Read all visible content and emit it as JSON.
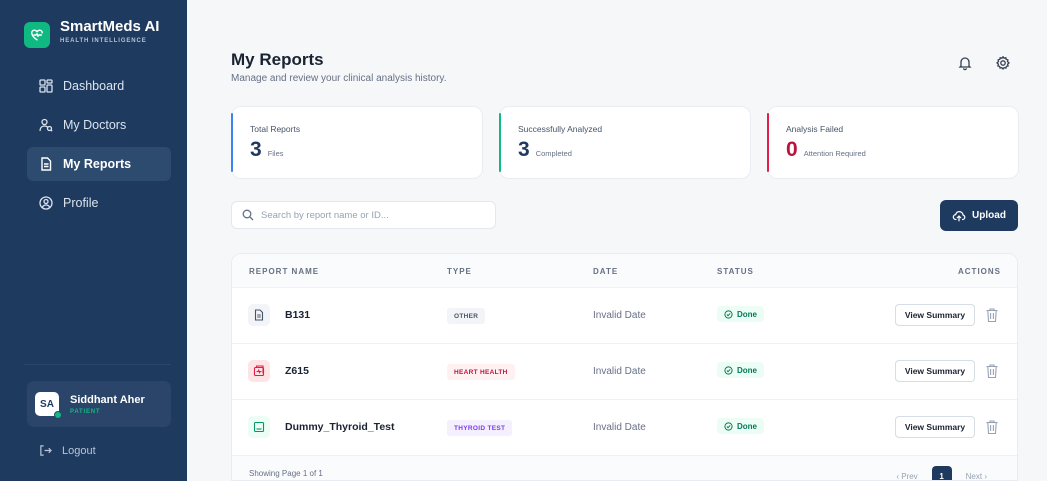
{
  "brand": {
    "name": "SmartMeds AI",
    "tagline": "HEALTH INTELLIGENCE"
  },
  "sidebar": {
    "items": [
      {
        "label": "Dashboard",
        "icon": "dashboard-icon"
      },
      {
        "label": "My Doctors",
        "icon": "doctor-icon"
      },
      {
        "label": "My Reports",
        "icon": "file-icon",
        "active": true
      },
      {
        "label": "Profile",
        "icon": "profile-icon"
      }
    ],
    "user": {
      "initials": "SA",
      "name": "Siddhant Aher",
      "role": "PATIENT"
    },
    "logout_label": "Logout"
  },
  "header": {
    "title": "My Reports",
    "subtitle": "Manage and review your clinical analysis history.",
    "icons": [
      "bell-icon",
      "settings-icon"
    ]
  },
  "stats": [
    {
      "label": "Total Reports",
      "value": "3",
      "unit": "Files",
      "color": "#3b82f6"
    },
    {
      "label": "Successfully Analyzed",
      "value": "3",
      "unit": "Completed",
      "color": "#10b981"
    },
    {
      "label": "Analysis Failed",
      "value": "0",
      "unit": "Attention Required",
      "color": "#e11d48"
    }
  ],
  "search": {
    "placeholder": "Search by report name or ID..."
  },
  "upload_label": "Upload",
  "table": {
    "headers": {
      "name": "REPORT NAME",
      "type": "TYPE",
      "date": "DATE",
      "status": "STATUS",
      "actions": "ACTIONS"
    },
    "rows": [
      {
        "name": "B131",
        "type": "OTHER",
        "date": "Invalid Date",
        "status": "Done",
        "action": "View Summary",
        "type_bg": "#f2f4f7",
        "type_fg": "#475467",
        "icon_bg": "#f2f4f7",
        "icon_fg": "#475467"
      },
      {
        "name": "Z615",
        "type": "HEART HEALTH",
        "date": "Invalid Date",
        "status": "Done",
        "action": "View Summary",
        "type_bg": "#fff1f2",
        "type_fg": "#be123c",
        "icon_bg": "#ffe4e6",
        "icon_fg": "#e11d48"
      },
      {
        "name": "Dummy_Thyroid_Test",
        "type": "THYROID TEST",
        "date": "Invalid Date",
        "status": "Done",
        "action": "View Summary",
        "type_bg": "#f5f0ff",
        "type_fg": "#7c3aed",
        "icon_bg": "#ecfdf5",
        "icon_fg": "#059669"
      }
    ],
    "footer": {
      "page_info": "Showing Page 1 of 1",
      "prev": "‹ Prev",
      "current": "1",
      "next": "Next ›"
    }
  }
}
